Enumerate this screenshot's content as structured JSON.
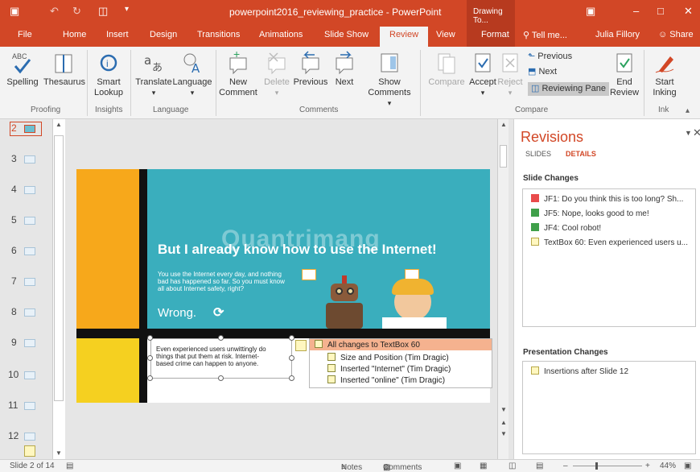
{
  "titlebar": {
    "document_title": "powerpoint2016_reviewing_practice - PowerPoint",
    "context_tab_group": "Drawing To...",
    "colors": {
      "accent": "#d24726"
    }
  },
  "tabs": [
    "File",
    "Home",
    "Insert",
    "Design",
    "Transitions",
    "Animations",
    "Slide Show",
    "Review",
    "View",
    "Format"
  ],
  "tell_me": "Tell me...",
  "user": "Julia Fillory",
  "share": "Share",
  "ribbon": {
    "spelling": "Spelling",
    "thesaurus": "Thesaurus",
    "smart_lookup": [
      "Smart",
      "Lookup"
    ],
    "translate": "Translate",
    "language": "Language",
    "new_comment": [
      "New",
      "Comment"
    ],
    "delete": "Delete",
    "previous": "Previous",
    "next": "Next",
    "show_comments": [
      "Show",
      "Comments"
    ],
    "compare": "Compare",
    "accept": "Accept",
    "reject": "Reject",
    "previous_small": "Previous",
    "next_small": "Next",
    "reviewing_pane": "Reviewing Pane",
    "end_review": [
      "End",
      "Review"
    ],
    "start_inking": [
      "Start",
      "Inking"
    ],
    "groups": [
      "Proofing",
      "Insights",
      "Language",
      "Comments",
      "Compare",
      "Ink"
    ]
  },
  "thumbnails": [
    "2",
    "3",
    "4",
    "5",
    "6",
    "7",
    "8",
    "9",
    "10",
    "11",
    "12"
  ],
  "slide": {
    "title": "But I already know how to use the Internet!",
    "body": [
      "You use the Internet every day, and nothing",
      "bad has happened so far. So you must know",
      "all about Internet safety, right?"
    ],
    "wrong": "Wrong.",
    "textbox": [
      "Even experienced users unwittingly do",
      "things that put them at risk. Internet-",
      "based crime can happen to anyone."
    ],
    "watermark": "Quantrimang"
  },
  "popup": {
    "header": "All changes to TextBox 60",
    "items": [
      "Size and Position (Tim Dragic)",
      "Inserted \"Internet\" (Tim Dragic)",
      "Inserted \"online\" (Tim Dragic)"
    ]
  },
  "revisions": {
    "title": "Revisions",
    "tab_slides": "SLIDES",
    "tab_details": "DETAILS",
    "slide_changes_heading": "Slide Changes",
    "slide_changes": [
      {
        "icon": "comment-red-icon",
        "text": "JF1: Do you think this is too long? Sh..."
      },
      {
        "icon": "comment-green-icon",
        "text": "JF5: Nope, looks good to me!"
      },
      {
        "icon": "comment-green-icon",
        "text": "JF4: Cool robot!"
      },
      {
        "icon": "edit-icon",
        "text": "TextBox 60: Even experienced users u..."
      }
    ],
    "presentation_changes_heading": "Presentation Changes",
    "presentation_changes": [
      {
        "icon": "edit-icon",
        "text": "Insertions after Slide 12"
      }
    ]
  },
  "status": {
    "slide_of": "Slide 2 of 14",
    "notes": "Notes",
    "comments": "Comments",
    "zoom": "44%"
  }
}
